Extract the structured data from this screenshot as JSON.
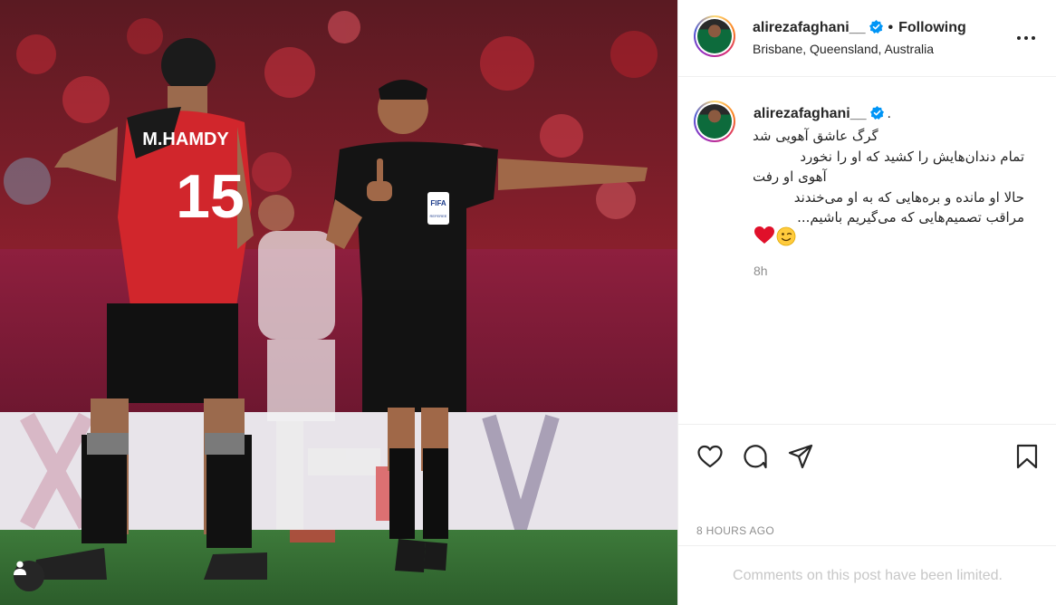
{
  "post": {
    "username": "alirezafaghani__",
    "follow_status": "Following",
    "location": "Brisbane, Queensland, Australia",
    "caption_period": ".",
    "caption_lines": [
      "گرگ عاشق آهویی شد",
      "تمام دندان‌هایش را کشید که او را نخورد",
      "آهوی او رفت",
      "حالا او مانده و بره‌هایی که به او می‌خندند",
      "مراقب تصمیم‌هایی که می‌گیریم باشیم..."
    ],
    "caption_emojis": [
      "❤️",
      "😉"
    ],
    "caption_time": "8h",
    "timestamp": "8 HOURS AGO",
    "comments_notice": "Comments on this post have been limited."
  },
  "photo": {
    "player_name": "M.HAMDY",
    "player_number": "15",
    "badge_text": "FIFA",
    "badge_sub": "REFEREE"
  },
  "icons": {
    "verified": "verified-badge-icon",
    "more": "more-options-icon",
    "like": "heart-icon",
    "comment": "comment-icon",
    "share": "paper-plane-icon",
    "save": "bookmark-icon",
    "tags": "user-tag-icon"
  },
  "colors": {
    "verified_blue": "#0095f6",
    "text_primary": "#262626",
    "text_secondary": "#8e8e8e",
    "comments_limited": "#c7c7c7"
  }
}
